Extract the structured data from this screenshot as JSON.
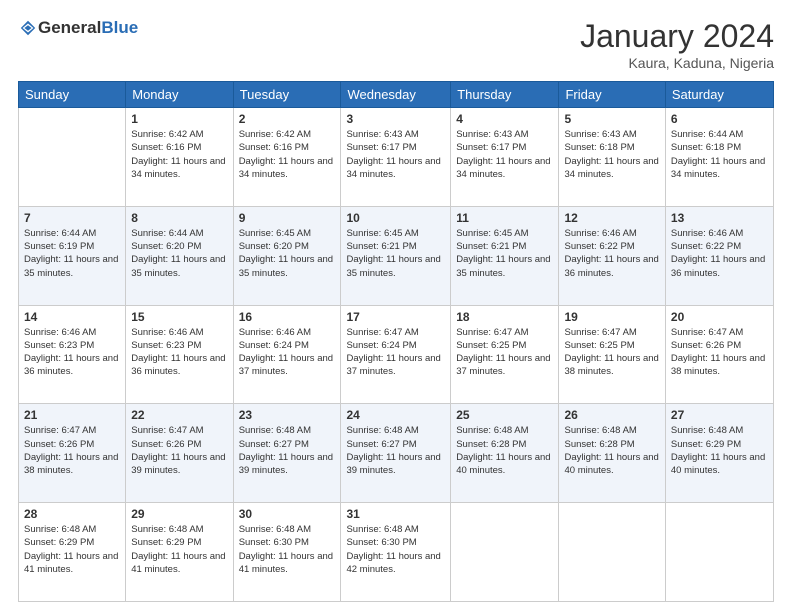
{
  "header": {
    "logo_general": "General",
    "logo_blue": "Blue",
    "month_title": "January 2024",
    "location": "Kaura, Kaduna, Nigeria"
  },
  "days_of_week": [
    "Sunday",
    "Monday",
    "Tuesday",
    "Wednesday",
    "Thursday",
    "Friday",
    "Saturday"
  ],
  "weeks": [
    [
      {
        "day": "",
        "sunrise": "",
        "sunset": "",
        "daylight": ""
      },
      {
        "day": "1",
        "sunrise": "Sunrise: 6:42 AM",
        "sunset": "Sunset: 6:16 PM",
        "daylight": "Daylight: 11 hours and 34 minutes."
      },
      {
        "day": "2",
        "sunrise": "Sunrise: 6:42 AM",
        "sunset": "Sunset: 6:16 PM",
        "daylight": "Daylight: 11 hours and 34 minutes."
      },
      {
        "day": "3",
        "sunrise": "Sunrise: 6:43 AM",
        "sunset": "Sunset: 6:17 PM",
        "daylight": "Daylight: 11 hours and 34 minutes."
      },
      {
        "day": "4",
        "sunrise": "Sunrise: 6:43 AM",
        "sunset": "Sunset: 6:17 PM",
        "daylight": "Daylight: 11 hours and 34 minutes."
      },
      {
        "day": "5",
        "sunrise": "Sunrise: 6:43 AM",
        "sunset": "Sunset: 6:18 PM",
        "daylight": "Daylight: 11 hours and 34 minutes."
      },
      {
        "day": "6",
        "sunrise": "Sunrise: 6:44 AM",
        "sunset": "Sunset: 6:18 PM",
        "daylight": "Daylight: 11 hours and 34 minutes."
      }
    ],
    [
      {
        "day": "7",
        "sunrise": "Sunrise: 6:44 AM",
        "sunset": "Sunset: 6:19 PM",
        "daylight": "Daylight: 11 hours and 35 minutes."
      },
      {
        "day": "8",
        "sunrise": "Sunrise: 6:44 AM",
        "sunset": "Sunset: 6:20 PM",
        "daylight": "Daylight: 11 hours and 35 minutes."
      },
      {
        "day": "9",
        "sunrise": "Sunrise: 6:45 AM",
        "sunset": "Sunset: 6:20 PM",
        "daylight": "Daylight: 11 hours and 35 minutes."
      },
      {
        "day": "10",
        "sunrise": "Sunrise: 6:45 AM",
        "sunset": "Sunset: 6:21 PM",
        "daylight": "Daylight: 11 hours and 35 minutes."
      },
      {
        "day": "11",
        "sunrise": "Sunrise: 6:45 AM",
        "sunset": "Sunset: 6:21 PM",
        "daylight": "Daylight: 11 hours and 35 minutes."
      },
      {
        "day": "12",
        "sunrise": "Sunrise: 6:46 AM",
        "sunset": "Sunset: 6:22 PM",
        "daylight": "Daylight: 11 hours and 36 minutes."
      },
      {
        "day": "13",
        "sunrise": "Sunrise: 6:46 AM",
        "sunset": "Sunset: 6:22 PM",
        "daylight": "Daylight: 11 hours and 36 minutes."
      }
    ],
    [
      {
        "day": "14",
        "sunrise": "Sunrise: 6:46 AM",
        "sunset": "Sunset: 6:23 PM",
        "daylight": "Daylight: 11 hours and 36 minutes."
      },
      {
        "day": "15",
        "sunrise": "Sunrise: 6:46 AM",
        "sunset": "Sunset: 6:23 PM",
        "daylight": "Daylight: 11 hours and 36 minutes."
      },
      {
        "day": "16",
        "sunrise": "Sunrise: 6:46 AM",
        "sunset": "Sunset: 6:24 PM",
        "daylight": "Daylight: 11 hours and 37 minutes."
      },
      {
        "day": "17",
        "sunrise": "Sunrise: 6:47 AM",
        "sunset": "Sunset: 6:24 PM",
        "daylight": "Daylight: 11 hours and 37 minutes."
      },
      {
        "day": "18",
        "sunrise": "Sunrise: 6:47 AM",
        "sunset": "Sunset: 6:25 PM",
        "daylight": "Daylight: 11 hours and 37 minutes."
      },
      {
        "day": "19",
        "sunrise": "Sunrise: 6:47 AM",
        "sunset": "Sunset: 6:25 PM",
        "daylight": "Daylight: 11 hours and 38 minutes."
      },
      {
        "day": "20",
        "sunrise": "Sunrise: 6:47 AM",
        "sunset": "Sunset: 6:26 PM",
        "daylight": "Daylight: 11 hours and 38 minutes."
      }
    ],
    [
      {
        "day": "21",
        "sunrise": "Sunrise: 6:47 AM",
        "sunset": "Sunset: 6:26 PM",
        "daylight": "Daylight: 11 hours and 38 minutes."
      },
      {
        "day": "22",
        "sunrise": "Sunrise: 6:47 AM",
        "sunset": "Sunset: 6:26 PM",
        "daylight": "Daylight: 11 hours and 39 minutes."
      },
      {
        "day": "23",
        "sunrise": "Sunrise: 6:48 AM",
        "sunset": "Sunset: 6:27 PM",
        "daylight": "Daylight: 11 hours and 39 minutes."
      },
      {
        "day": "24",
        "sunrise": "Sunrise: 6:48 AM",
        "sunset": "Sunset: 6:27 PM",
        "daylight": "Daylight: 11 hours and 39 minutes."
      },
      {
        "day": "25",
        "sunrise": "Sunrise: 6:48 AM",
        "sunset": "Sunset: 6:28 PM",
        "daylight": "Daylight: 11 hours and 40 minutes."
      },
      {
        "day": "26",
        "sunrise": "Sunrise: 6:48 AM",
        "sunset": "Sunset: 6:28 PM",
        "daylight": "Daylight: 11 hours and 40 minutes."
      },
      {
        "day": "27",
        "sunrise": "Sunrise: 6:48 AM",
        "sunset": "Sunset: 6:29 PM",
        "daylight": "Daylight: 11 hours and 40 minutes."
      }
    ],
    [
      {
        "day": "28",
        "sunrise": "Sunrise: 6:48 AM",
        "sunset": "Sunset: 6:29 PM",
        "daylight": "Daylight: 11 hours and 41 minutes."
      },
      {
        "day": "29",
        "sunrise": "Sunrise: 6:48 AM",
        "sunset": "Sunset: 6:29 PM",
        "daylight": "Daylight: 11 hours and 41 minutes."
      },
      {
        "day": "30",
        "sunrise": "Sunrise: 6:48 AM",
        "sunset": "Sunset: 6:30 PM",
        "daylight": "Daylight: 11 hours and 41 minutes."
      },
      {
        "day": "31",
        "sunrise": "Sunrise: 6:48 AM",
        "sunset": "Sunset: 6:30 PM",
        "daylight": "Daylight: 11 hours and 42 minutes."
      },
      {
        "day": "",
        "sunrise": "",
        "sunset": "",
        "daylight": ""
      },
      {
        "day": "",
        "sunrise": "",
        "sunset": "",
        "daylight": ""
      },
      {
        "day": "",
        "sunrise": "",
        "sunset": "",
        "daylight": ""
      }
    ]
  ]
}
